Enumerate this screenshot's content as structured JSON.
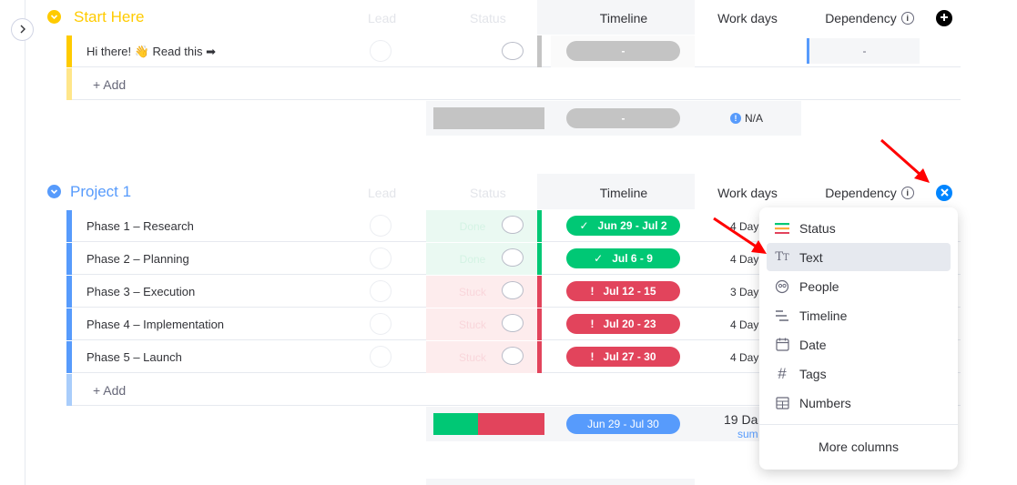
{
  "groups": [
    {
      "title": "Start Here",
      "color": "#ffcb00",
      "columns": {
        "lead": "Lead",
        "status": "Status",
        "timeline": "Timeline",
        "work_days": "Work days",
        "dependency": "Dependency"
      },
      "rows": [
        {
          "label": "Hi there! 👋 Read this ➡",
          "timeline": "-",
          "dependency": "-"
        }
      ],
      "add_label": "+ Add",
      "summary": {
        "timeline": "-",
        "work_days": "N/A"
      }
    },
    {
      "title": "Project 1",
      "color": "#579bfc",
      "columns": {
        "lead": "Lead",
        "status": "Status",
        "timeline": "Timeline",
        "work_days": "Work days",
        "dependency": "Dependency"
      },
      "rows": [
        {
          "label": "Phase 1 – Research",
          "status": "Done",
          "timeline": "Jun 29 - Jul 2",
          "work_days": "4 Day"
        },
        {
          "label": "Phase 2 – Planning",
          "status": "Done",
          "timeline": "Jul 6 - 9",
          "work_days": "4 Day"
        },
        {
          "label": "Phase 3 – Execution",
          "status": "Stuck",
          "timeline": "Jul 12 - 15",
          "work_days": "3 Day"
        },
        {
          "label": "Phase 4 – Implementation",
          "status": "Stuck",
          "timeline": "Jul 20 - 23",
          "work_days": "4 Day"
        },
        {
          "label": "Phase 5 – Launch",
          "status": "Stuck",
          "timeline": "Jul 27 - 30",
          "work_days": "4 Day"
        }
      ],
      "add_label": "+ Add",
      "summary": {
        "timeline": "Jun 29 - Jul 30",
        "work_days": "19 Da",
        "work_days_sub": "sum"
      }
    }
  ],
  "colors": {
    "done": "#00c875",
    "stuck": "#e2445c",
    "timeline_blue": "#579bfc",
    "empty_gray": "#c4c4c4",
    "close_blue": "#0085ff",
    "arrow_red": "#ff0000"
  },
  "add_column_menu": {
    "items": [
      {
        "label": "Status",
        "icon": "status-lines-icon"
      },
      {
        "label": "Text",
        "icon": "text-tt-icon",
        "highlighted": true
      },
      {
        "label": "People",
        "icon": "people-icon"
      },
      {
        "label": "Timeline",
        "icon": "timeline-icon"
      },
      {
        "label": "Date",
        "icon": "calendar-icon"
      },
      {
        "label": "Tags",
        "icon": "hash-icon"
      },
      {
        "label": "Numbers",
        "icon": "numbers-icon"
      }
    ],
    "more_label": "More columns"
  }
}
